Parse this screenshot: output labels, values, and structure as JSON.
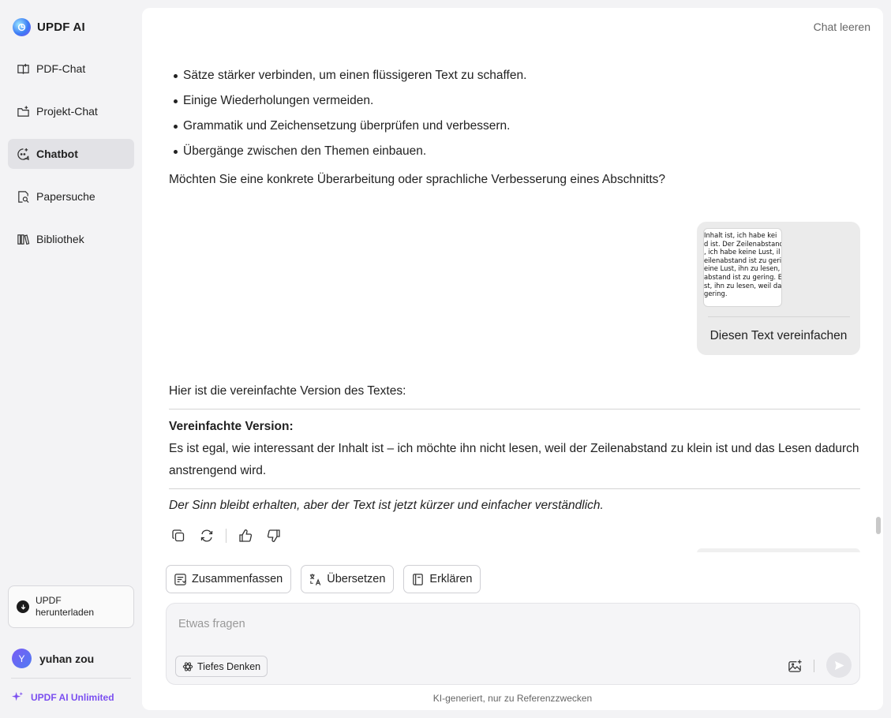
{
  "brand": {
    "name": "UPDF AI"
  },
  "sidebar": {
    "items": [
      {
        "label": "PDF-Chat",
        "icon": "book-open-icon",
        "active": false
      },
      {
        "label": "Projekt-Chat",
        "icon": "folder-plus-icon",
        "active": false
      },
      {
        "label": "Chatbot",
        "icon": "chat-bot-icon",
        "active": true
      },
      {
        "label": "Papersuche",
        "icon": "document-search-icon",
        "active": false
      },
      {
        "label": "Bibliothek",
        "icon": "library-icon",
        "active": false
      }
    ],
    "download": {
      "line1": "UPDF",
      "line2": "herunterladen"
    },
    "user": {
      "initial": "Y",
      "name": "yuhan zou"
    },
    "upgrade": "UPDF AI Unlimited"
  },
  "header": {
    "clear_chat": "Chat leeren"
  },
  "chat": {
    "bullets": [
      "Sätze stärker verbinden, um einen flüssigeren Text zu schaffen.",
      "Einige Wiederholungen vermeiden.",
      "Grammatik und Zeichensetzung überprüfen und verbessern.",
      "Übergänge zwischen den Themen einbauen."
    ],
    "question": "Möchten Sie eine konkrete Überarbeitung oder sprachliche Verbesserung eines Abschnitts?",
    "user_message": {
      "image_lines": [
        " Inhalt ist, ich habe kei",
        "d ist. Der Zeilenabstand",
        ", ich habe keine Lust, il",
        "eilenabstand ist zu gerin",
        "eine Lust, ihn zu lesen,",
        "abstand ist zu gering. E",
        "st, ihn zu lesen, weil da",
        " gering."
      ],
      "text": "Diesen Text vereinfachen"
    },
    "reply": {
      "intro": "Hier ist die vereinfachte Version des Textes:",
      "heading": "Vereinfachte Version:",
      "body": "Es ist egal, wie interessant der Inhalt ist – ich möchte ihn nicht lesen, weil der Zeilenabstand zu klein ist und das Lesen dadurch anstrengend wird.",
      "note": "Der Sinn bleibt erhalten, aber der Text ist jetzt kürzer und einfacher verständlich."
    }
  },
  "quick_actions": [
    {
      "label": "Zusammenfassen",
      "icon": "summarize-icon"
    },
    {
      "label": "Übersetzen",
      "icon": "translate-icon"
    },
    {
      "label": "Erklären",
      "icon": "book-icon"
    }
  ],
  "input": {
    "placeholder": "Etwas fragen",
    "value": "",
    "deep_thinking": "Tiefes Denken"
  },
  "disclaimer": "KI-generiert, nur zu Referenzzwecken"
}
